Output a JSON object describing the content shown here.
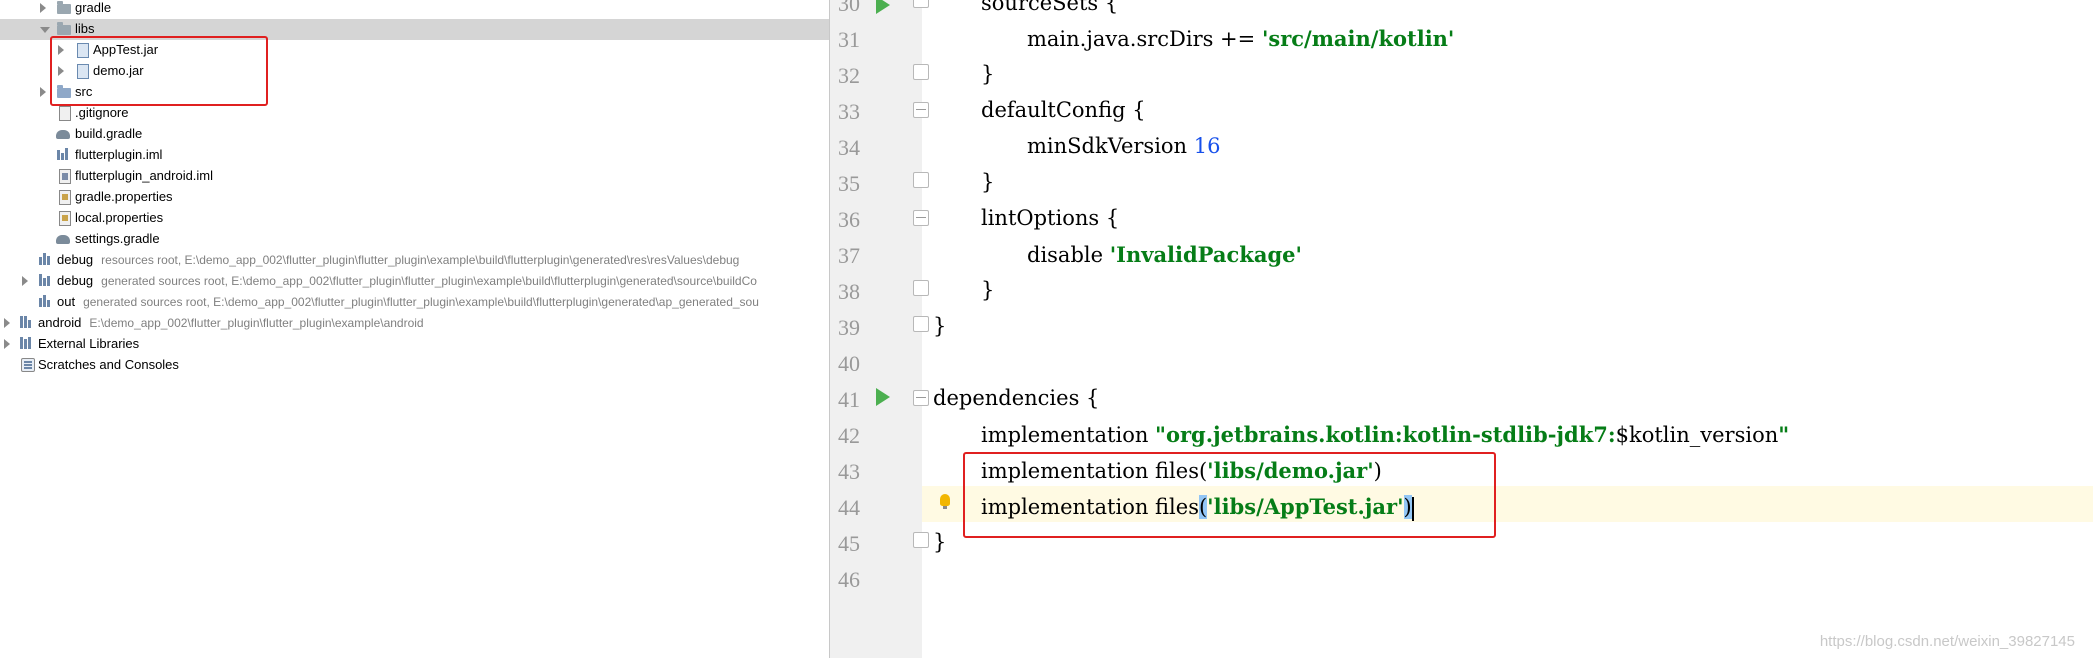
{
  "tree": {
    "rows": [
      {
        "label": "gradle",
        "hint": ""
      },
      {
        "label": "libs",
        "hint": ""
      },
      {
        "label": "AppTest.jar",
        "hint": ""
      },
      {
        "label": "demo.jar",
        "hint": ""
      },
      {
        "label": "src",
        "hint": ""
      },
      {
        "label": ".gitignore",
        "hint": ""
      },
      {
        "label": "build.gradle",
        "hint": ""
      },
      {
        "label": "flutterplugin.iml",
        "hint": ""
      },
      {
        "label": "flutterplugin_android.iml",
        "hint": ""
      },
      {
        "label": "gradle.properties",
        "hint": ""
      },
      {
        "label": "local.properties",
        "hint": ""
      },
      {
        "label": "settings.gradle",
        "hint": ""
      },
      {
        "label": "debug",
        "hint": "resources root,  E:\\demo_app_002\\flutter_plugin\\flutter_plugin\\example\\build\\flutterplugin\\generated\\res\\resValues\\debug"
      },
      {
        "label": "debug",
        "hint": "generated sources root,  E:\\demo_app_002\\flutter_plugin\\flutter_plugin\\example\\build\\flutterplugin\\generated\\source\\buildCo"
      },
      {
        "label": "out",
        "hint": "generated sources root,  E:\\demo_app_002\\flutter_plugin\\flutter_plugin\\example\\build\\flutterplugin\\generated\\ap_generated_sou"
      },
      {
        "label": "android",
        "hint": "E:\\demo_app_002\\flutter_plugin\\flutter_plugin\\example\\android"
      },
      {
        "label": "External Libraries",
        "hint": ""
      },
      {
        "label": "Scratches and Consoles",
        "hint": ""
      }
    ]
  },
  "editor": {
    "line_numbers": [
      "30",
      "31",
      "32",
      "33",
      "34",
      "35",
      "36",
      "37",
      "38",
      "39",
      "40",
      "41",
      "42",
      "43",
      "44",
      "45",
      "46"
    ],
    "code": {
      "l30": "sourceSets {",
      "l31_a": "main.java.srcDirs += ",
      "l31_s": "'src/main/kotlin'",
      "l32": "}",
      "l33": "defaultConfig {",
      "l34_a": "minSdkVersion ",
      "l34_n": "16",
      "l35": "}",
      "l36": "lintOptions {",
      "l37_a": "disable ",
      "l37_s": "'InvalidPackage'",
      "l38": "}",
      "l39": "}",
      "l41": "dependencies {",
      "l42_a": "implementation ",
      "l42_s": "\"org.jetbrains.kotlin:kotlin-stdlib-jdk7:",
      "l42_b": "$kotlin_version",
      "l42_e": "\"",
      "l43_a": "implementation files(",
      "l43_s": "'libs/demo.jar'",
      "l43_e": ")",
      "l44_a": "implementation files",
      "l44_p1": "(",
      "l44_s": "'libs/AppTest.jar'",
      "l44_p2": ")",
      "l45": "}"
    }
  },
  "watermark": "https://blog.csdn.net/weixin_39827145",
  "colors": {
    "string": "#067d17",
    "number": "#1750eb",
    "highlight_box": "#e02020",
    "current_line": "#fffae3"
  }
}
